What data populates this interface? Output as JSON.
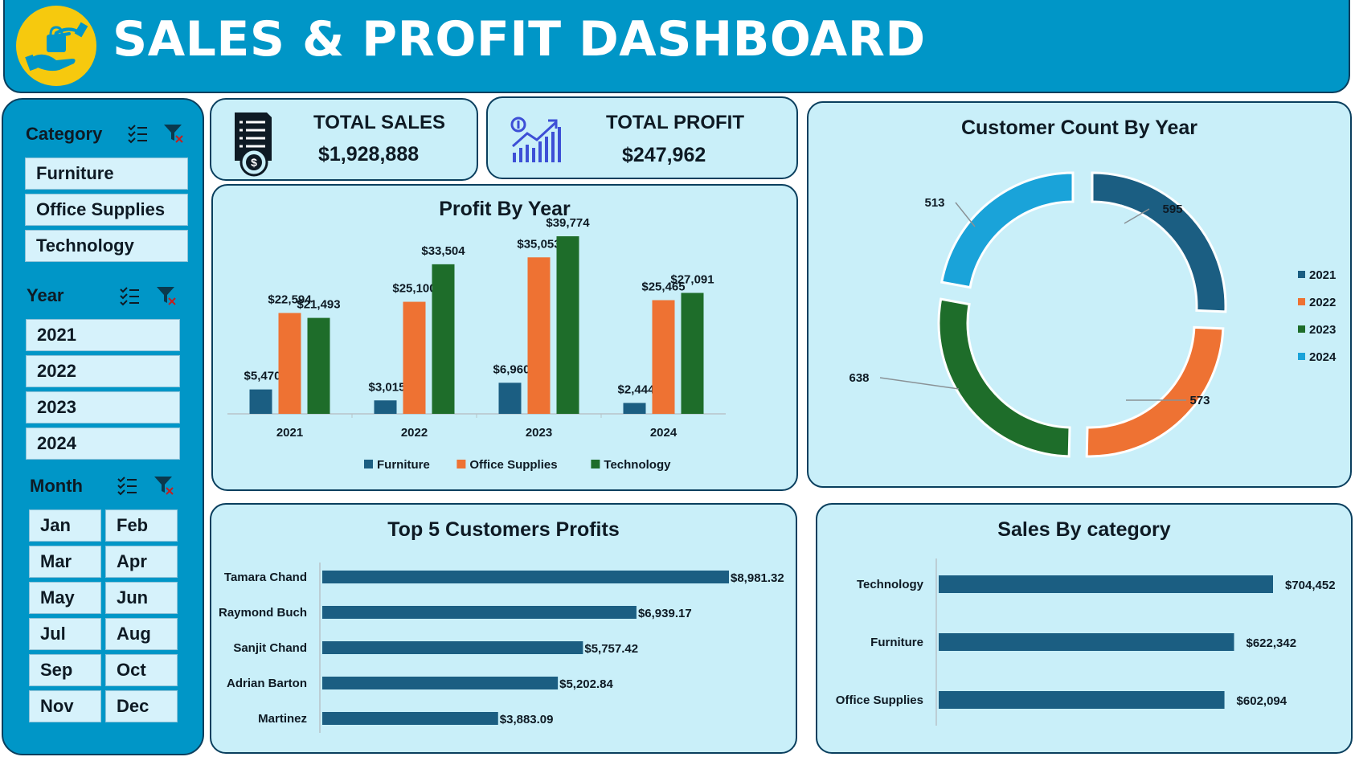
{
  "header": {
    "title": "SALES & PROFIT DASHBOARD"
  },
  "colors": {
    "furniture": "#1b5e82",
    "office_supplies": "#ee7233",
    "technology": "#1e6d2a",
    "y2021": "#1b5e82",
    "y2022": "#ee7233",
    "y2023": "#1e6d2a",
    "y2024": "#1aa3d9",
    "bar": "#1b5e82",
    "panel": "#0096c7",
    "card": "#c9eff9"
  },
  "slicers": {
    "category": {
      "title": "Category",
      "items": [
        "Furniture",
        "Office Supplies",
        "Technology"
      ]
    },
    "year": {
      "title": "Year",
      "items": [
        "2021",
        "2022",
        "2023",
        "2024"
      ]
    },
    "month": {
      "title": "Month",
      "items": [
        "Jan",
        "Feb",
        "Mar",
        "Apr",
        "May",
        "Jun",
        "Jul",
        "Aug",
        "Sep",
        "Oct",
        "Nov",
        "Dec"
      ]
    }
  },
  "kpis": {
    "total_sales": {
      "label": "TOTAL SALES",
      "value": "$1,928,888",
      "icon": "invoice-dollar-icon"
    },
    "total_profit": {
      "label": "TOTAL PROFIT",
      "value": "$247,962",
      "icon": "growth-chart-icon"
    }
  },
  "chart_data": [
    {
      "id": "profit_by_year",
      "type": "bar",
      "title": "Profit By Year",
      "categories": [
        "2021",
        "2022",
        "2023",
        "2024"
      ],
      "series": [
        {
          "name": "Furniture",
          "values": [
            5470,
            3015,
            6960,
            2444
          ],
          "labels": [
            "$5,470",
            "$3,015",
            "$6,960",
            "$2,444"
          ]
        },
        {
          "name": "Office Supplies",
          "values": [
            22594,
            25100,
            35053,
            25465
          ],
          "labels": [
            "$22,594",
            "$25,100",
            "$35,053",
            "$25,465"
          ]
        },
        {
          "name": "Technology",
          "values": [
            21493,
            33504,
            39774,
            27091
          ],
          "labels": [
            "$21,493",
            "$33,504",
            "$39,774",
            "$27,091"
          ]
        }
      ],
      "ylim": [
        0,
        45000
      ],
      "legend": "bottom"
    },
    {
      "id": "customer_count_by_year",
      "type": "pie",
      "title": "Customer Count By Year",
      "labels": [
        "2021",
        "2022",
        "2023",
        "2024"
      ],
      "values": [
        595,
        573,
        638,
        513
      ],
      "legend": "right"
    },
    {
      "id": "top5_customers_profits",
      "type": "bar",
      "orientation": "horizontal",
      "title": "Top 5 Customers Profits",
      "categories": [
        "Tamara Chand",
        "Raymond Buch",
        "Sanjit Chand",
        "Adrian Barton",
        "Martinez"
      ],
      "values": [
        8981.32,
        6939.17,
        5757.42,
        5202.84,
        3883.09
      ],
      "labels": [
        "$8,981.32",
        "$6,939.17",
        "$5,757.42",
        "$5,202.84",
        "$3,883.09"
      ],
      "xlim": [
        0,
        8981.32
      ]
    },
    {
      "id": "sales_by_category",
      "type": "bar",
      "orientation": "horizontal",
      "title": "Sales By category",
      "categories": [
        "Technology",
        "Furniture",
        "Office Supplies"
      ],
      "values": [
        704452,
        622342,
        602094
      ],
      "labels": [
        "$704,452",
        "$622,342",
        "$602,094"
      ],
      "xlim": [
        0,
        704452
      ]
    }
  ]
}
